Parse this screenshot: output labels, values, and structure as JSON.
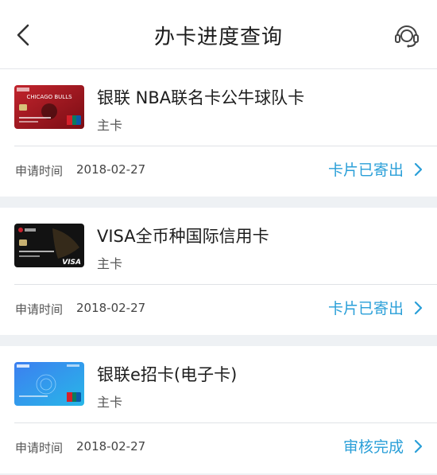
{
  "header": {
    "title": "办卡进度查询"
  },
  "cards": [
    {
      "name": "银联 NBA联名卡公牛球队卡",
      "type": "主卡",
      "apply_label": "申请时间",
      "apply_date": "2018-02-27",
      "status": "卡片已寄出"
    },
    {
      "name": "VISA全币种国际信用卡",
      "type": "主卡",
      "apply_label": "申请时间",
      "apply_date": "2018-02-27",
      "status": "卡片已寄出"
    },
    {
      "name": "银联e招卡(电子卡)",
      "type": "主卡",
      "apply_label": "申请时间",
      "apply_date": "2018-02-27",
      "status": "审核完成"
    }
  ],
  "card_art": {
    "bulls_text": "CHICAGO BULLS",
    "visa_text": "VISA"
  },
  "colors": {
    "accent": "#2a9fd8",
    "page_bg": "#eef1f4"
  }
}
